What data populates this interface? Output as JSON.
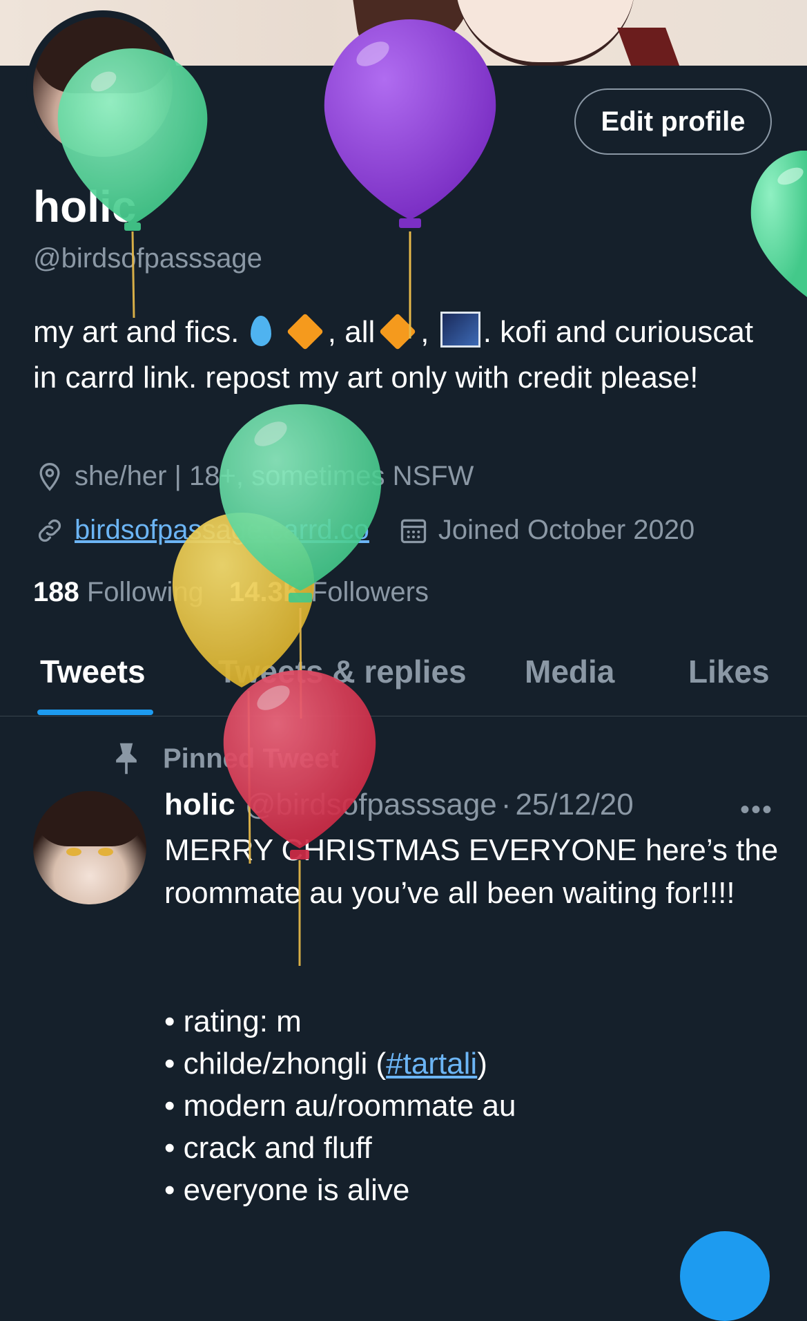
{
  "profile": {
    "name": "holic",
    "handle": "@birdsofpasssage",
    "edit_label": "Edit profile",
    "bio": {
      "part1": "my art and fics.",
      "part2": ", all",
      "part3": ",",
      "part4": ". kofi and curiouscat in carrd link. repost my art only with credit please!"
    },
    "location": "she/her | 18+, sometimes NSFW",
    "website": "birdsofpassage.carrd.co",
    "joined": "Joined October 2020",
    "following_count": "188",
    "following_label": "Following",
    "followers_count": "14.3K",
    "followers_label": "Followers"
  },
  "tabs": [
    {
      "label": "Tweets",
      "active": true
    },
    {
      "label": "Tweets & replies",
      "active": false
    },
    {
      "label": "Media",
      "active": false
    },
    {
      "label": "Likes",
      "active": false
    }
  ],
  "pinned": {
    "label": "Pinned Tweet",
    "author": "holic",
    "handle": "@birdsofpasssage",
    "separator": "·",
    "date": "25/12/20",
    "more": "•••",
    "text": "MERRY CHRISTMAS EVERYONE here’s the roommate au you’ve all been waiting for!!!!",
    "bullets": {
      "b1": "rating: m",
      "b2_prefix": "childe/zhongli (",
      "b2_hashtag": "#tartali",
      "b2_suffix": ")",
      "b3": "modern au/roommate au",
      "b4": "crack and fluff",
      "b5": "everyone is alive"
    }
  },
  "icons": {
    "location": "location-pin-icon",
    "link": "link-icon",
    "calendar": "calendar-icon",
    "pin": "pin-icon",
    "more": "more-icon"
  },
  "colors": {
    "background": "#15202b",
    "accent": "#1d9bf0",
    "muted_text": "#8b98a5",
    "link": "#6cb5f5",
    "balloon_green": "#4fd69a",
    "balloon_purple": "#8a3fd1",
    "balloon_yellow": "#e7c03a",
    "balloon_red": "#d8334f"
  }
}
